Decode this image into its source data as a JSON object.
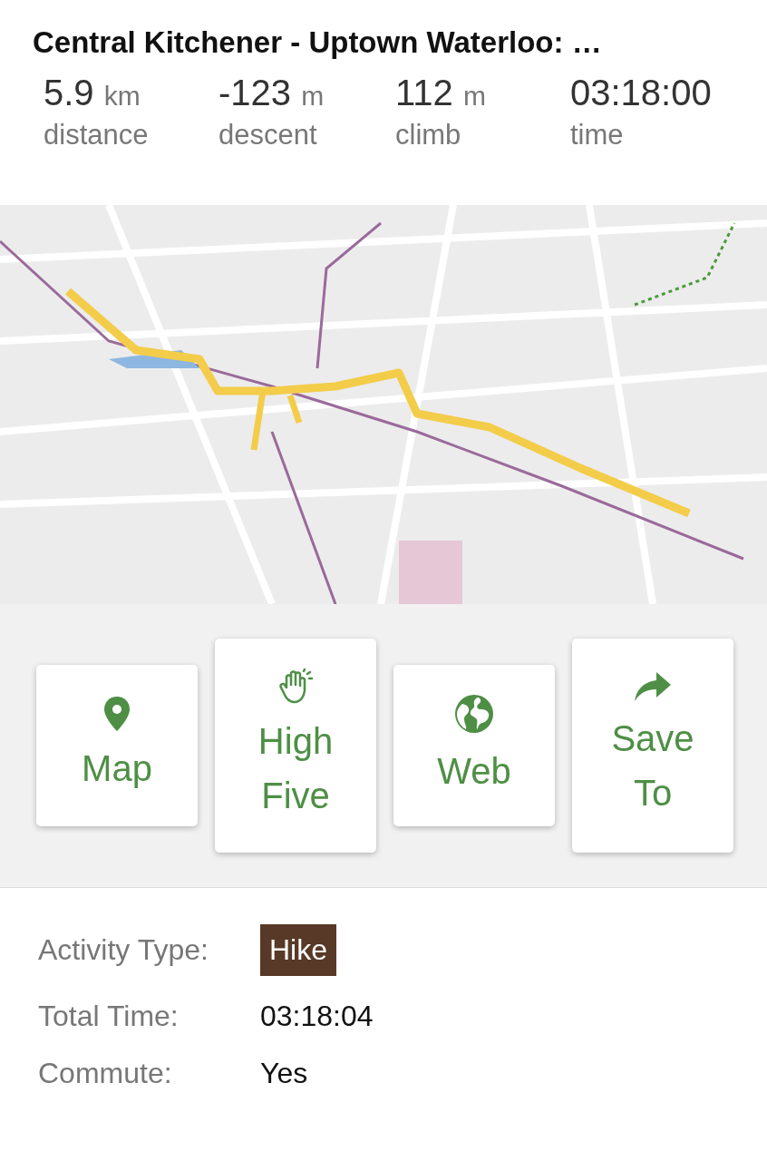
{
  "title": "Central Kitchener - Uptown Waterloo: …",
  "stats": [
    {
      "value": "5.9",
      "unit": "km",
      "label": "distance"
    },
    {
      "value": "-123",
      "unit": "m",
      "label": "descent"
    },
    {
      "value": "112",
      "unit": "m",
      "label": "climb"
    },
    {
      "value": "03:18:00",
      "label": "time"
    }
  ],
  "actions": [
    {
      "label": "Map",
      "kind": "pin"
    },
    {
      "label": "High Five",
      "kind": "hand"
    },
    {
      "label": "Web",
      "kind": "globe"
    },
    {
      "label": "Save To",
      "kind": "share"
    }
  ],
  "details": [
    {
      "label": "Activity Type:",
      "value": "Hike",
      "kind": "badge"
    },
    {
      "label": "Total Time:",
      "value": "03:18:04",
      "kind": "text"
    },
    {
      "label": "Commute:",
      "value": "Yes",
      "kind": "text"
    }
  ]
}
